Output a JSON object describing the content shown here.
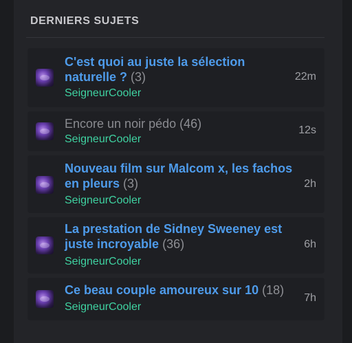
{
  "section": {
    "title": "DERNIERS SUJETS"
  },
  "topics": [
    {
      "title": "C'est quoi au juste la sélection naturelle ?",
      "count": "(3)",
      "author": "SeigneurCooler",
      "time": "22m"
    },
    {
      "title": "Encore un noir pédo",
      "count": "(46)",
      "author": "SeigneurCooler",
      "time": "12s"
    },
    {
      "title": "Nouveau film sur Malcom x, les fachos en pleurs",
      "count": "(3)",
      "author": "SeigneurCooler",
      "time": "2h"
    },
    {
      "title": "La prestation de Sidney Sweeney est juste incroyable",
      "count": "(36)",
      "author": "SeigneurCooler",
      "time": "6h"
    },
    {
      "title": "Ce beau couple amoureux sur 10",
      "count": "(18)",
      "author": "SeigneurCooler",
      "time": "7h"
    }
  ]
}
